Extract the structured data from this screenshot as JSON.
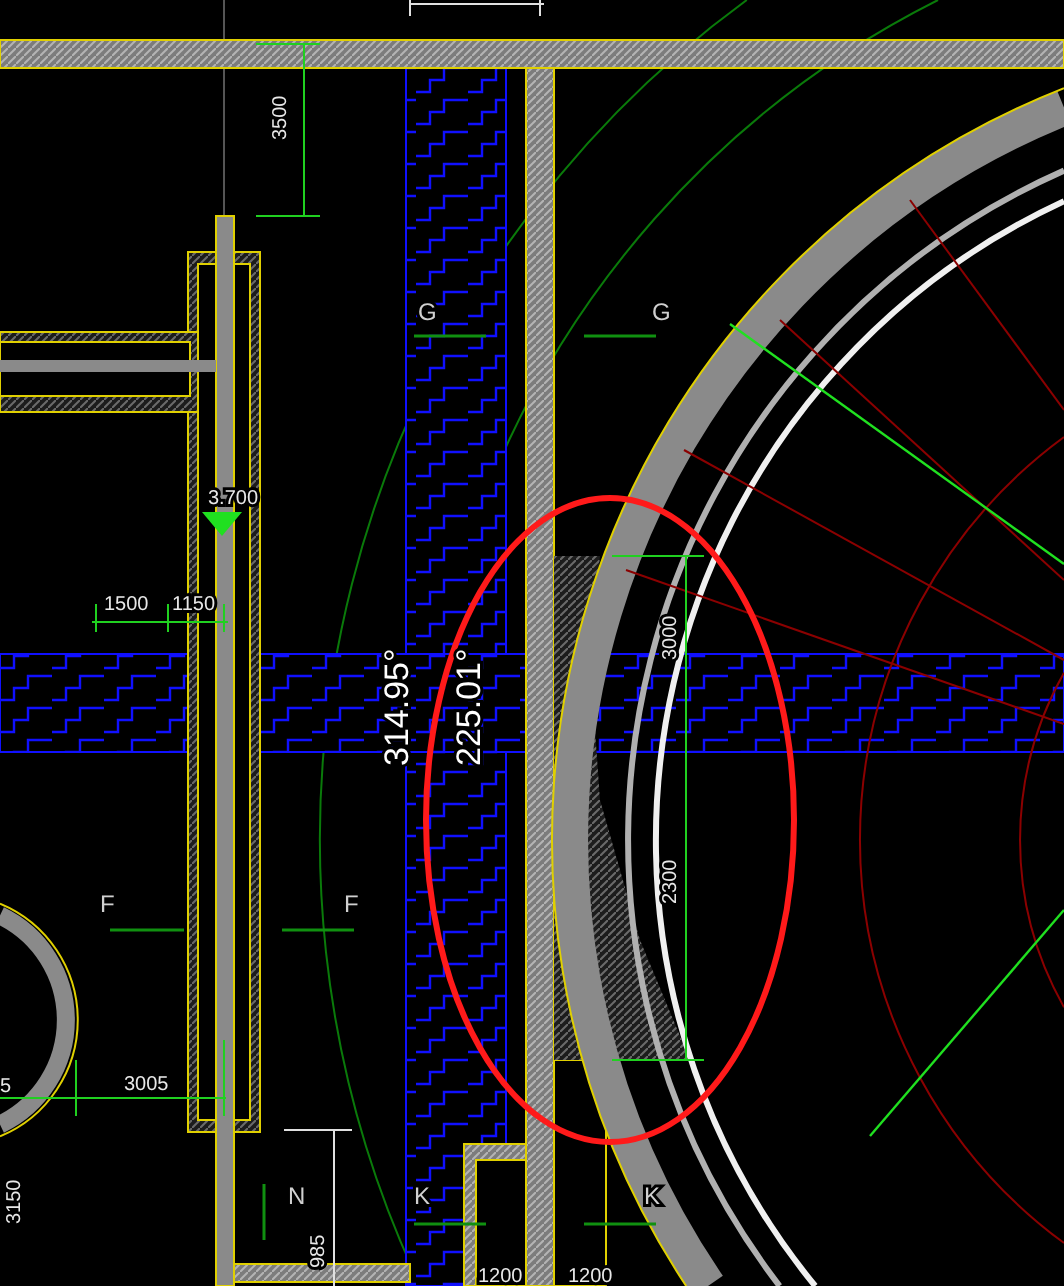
{
  "drawing": {
    "labels": [
      {
        "text": "3500",
        "kind": "dimension"
      },
      {
        "text": "G",
        "kind": "section"
      },
      {
        "text": "G",
        "kind": "section"
      },
      {
        "text": "3.700",
        "kind": "elevation"
      },
      {
        "text": "1500",
        "kind": "dimension"
      },
      {
        "text": "1150",
        "kind": "dimension"
      },
      {
        "text": "314.95°",
        "kind": "angle"
      },
      {
        "text": "225.01°",
        "kind": "angle"
      },
      {
        "text": "3000",
        "kind": "dimension"
      },
      {
        "text": "2300",
        "kind": "dimension"
      },
      {
        "text": "F",
        "kind": "section"
      },
      {
        "text": "F",
        "kind": "section"
      },
      {
        "text": "5",
        "kind": "dimension"
      },
      {
        "text": "3005",
        "kind": "dimension"
      },
      {
        "text": "3150",
        "kind": "dimension"
      },
      {
        "text": "N",
        "kind": "section"
      },
      {
        "text": "K",
        "kind": "section"
      },
      {
        "text": "K",
        "kind": "section"
      },
      {
        "text": "985",
        "kind": "dimension"
      },
      {
        "text": "1200",
        "kind": "dimension"
      },
      {
        "text": "1200",
        "kind": "dimension"
      }
    ]
  }
}
